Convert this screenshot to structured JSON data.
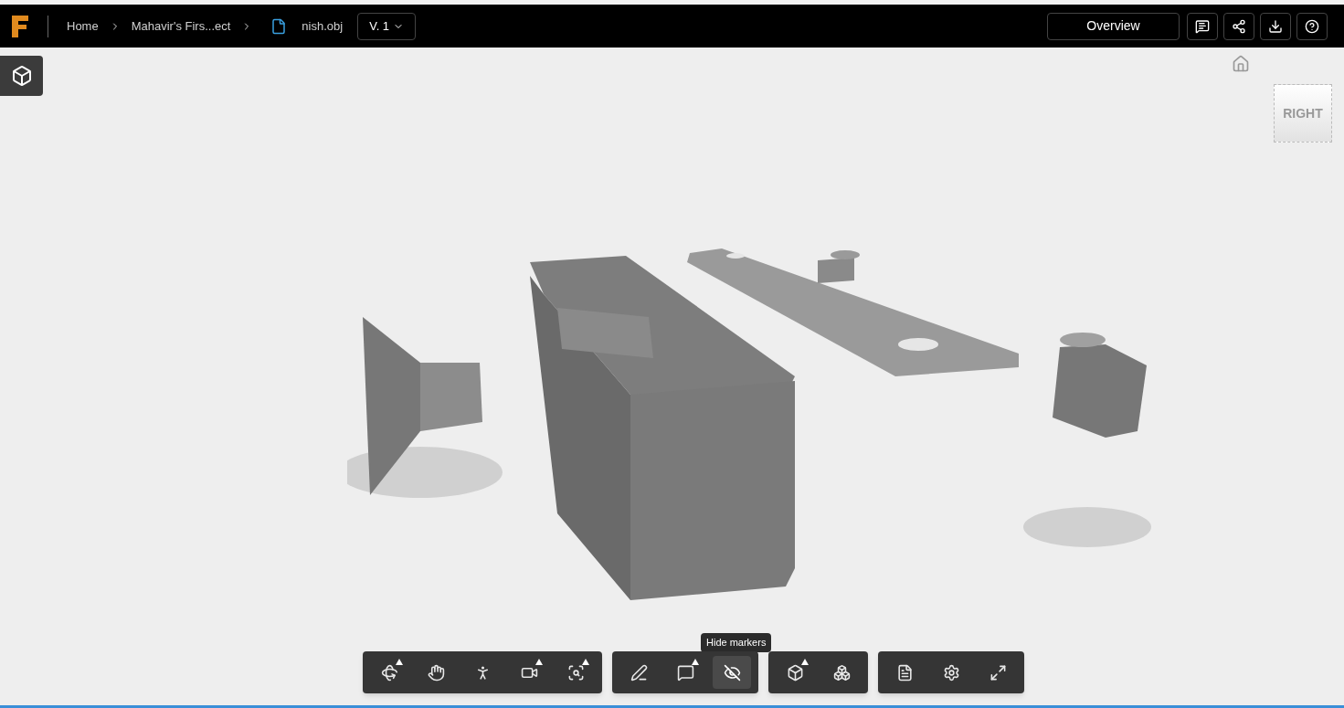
{
  "breadcrumbs": [
    {
      "label": "Home",
      "kind": "link"
    },
    {
      "label": "Mahavir's Firs...ect",
      "kind": "link"
    },
    {
      "label": "nish.obj",
      "kind": "file"
    }
  ],
  "version": "V. 1",
  "header_buttons": [
    {
      "label": "Overview",
      "kind": "text"
    },
    {
      "kind": "comments"
    },
    {
      "kind": "share"
    },
    {
      "kind": "download"
    },
    {
      "kind": "help"
    }
  ],
  "view_cube": {
    "face": "RIGHT"
  },
  "tooltip": "Hide markers",
  "toolbar": [
    [
      {
        "kind": "orbit",
        "menu": true,
        "selected": false
      },
      {
        "kind": "pan",
        "menu": false,
        "selected": false
      },
      {
        "kind": "walk",
        "menu": false,
        "selected": false
      },
      {
        "kind": "camera",
        "menu": true,
        "selected": false
      },
      {
        "kind": "zoom-window",
        "menu": true,
        "selected": false
      }
    ],
    [
      {
        "kind": "markup",
        "menu": false,
        "selected": false
      },
      {
        "kind": "comment",
        "menu": true,
        "selected": false
      },
      {
        "kind": "hide-markers",
        "menu": false,
        "selected": true
      }
    ],
    [
      {
        "kind": "explode",
        "menu": true,
        "selected": false
      },
      {
        "kind": "model",
        "menu": false,
        "selected": false
      }
    ],
    [
      {
        "kind": "properties",
        "menu": false,
        "selected": false
      },
      {
        "kind": "settings",
        "menu": false,
        "selected": false
      },
      {
        "kind": "fullscreen",
        "menu": false,
        "selected": false
      }
    ]
  ]
}
